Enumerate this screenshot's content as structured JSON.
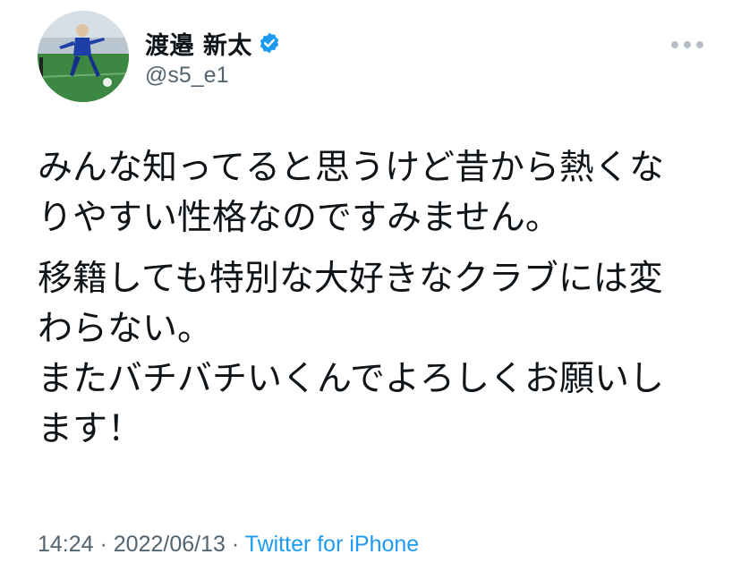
{
  "user": {
    "display_name": "渡邉 新太",
    "handle": "@s5_e1"
  },
  "tweet": {
    "paragraphs": [
      [
        "みんな知ってると思うけど昔から熱くな",
        "りやすい性格なのですみません。"
      ],
      [
        "移籍しても特別な大好きなクラブには変",
        "わらない。",
        "またバチバチいくんでよろしくお願いし",
        "ます！"
      ]
    ]
  },
  "meta": {
    "time": "14:24",
    "date": "2022/06/13",
    "separator": " · ",
    "source": "Twitter for iPhone"
  },
  "icons": {
    "verified": "verified-badge-icon",
    "more": "more-options-icon"
  },
  "colors": {
    "accent": "#1d9bf0",
    "secondary_text": "#536471"
  }
}
